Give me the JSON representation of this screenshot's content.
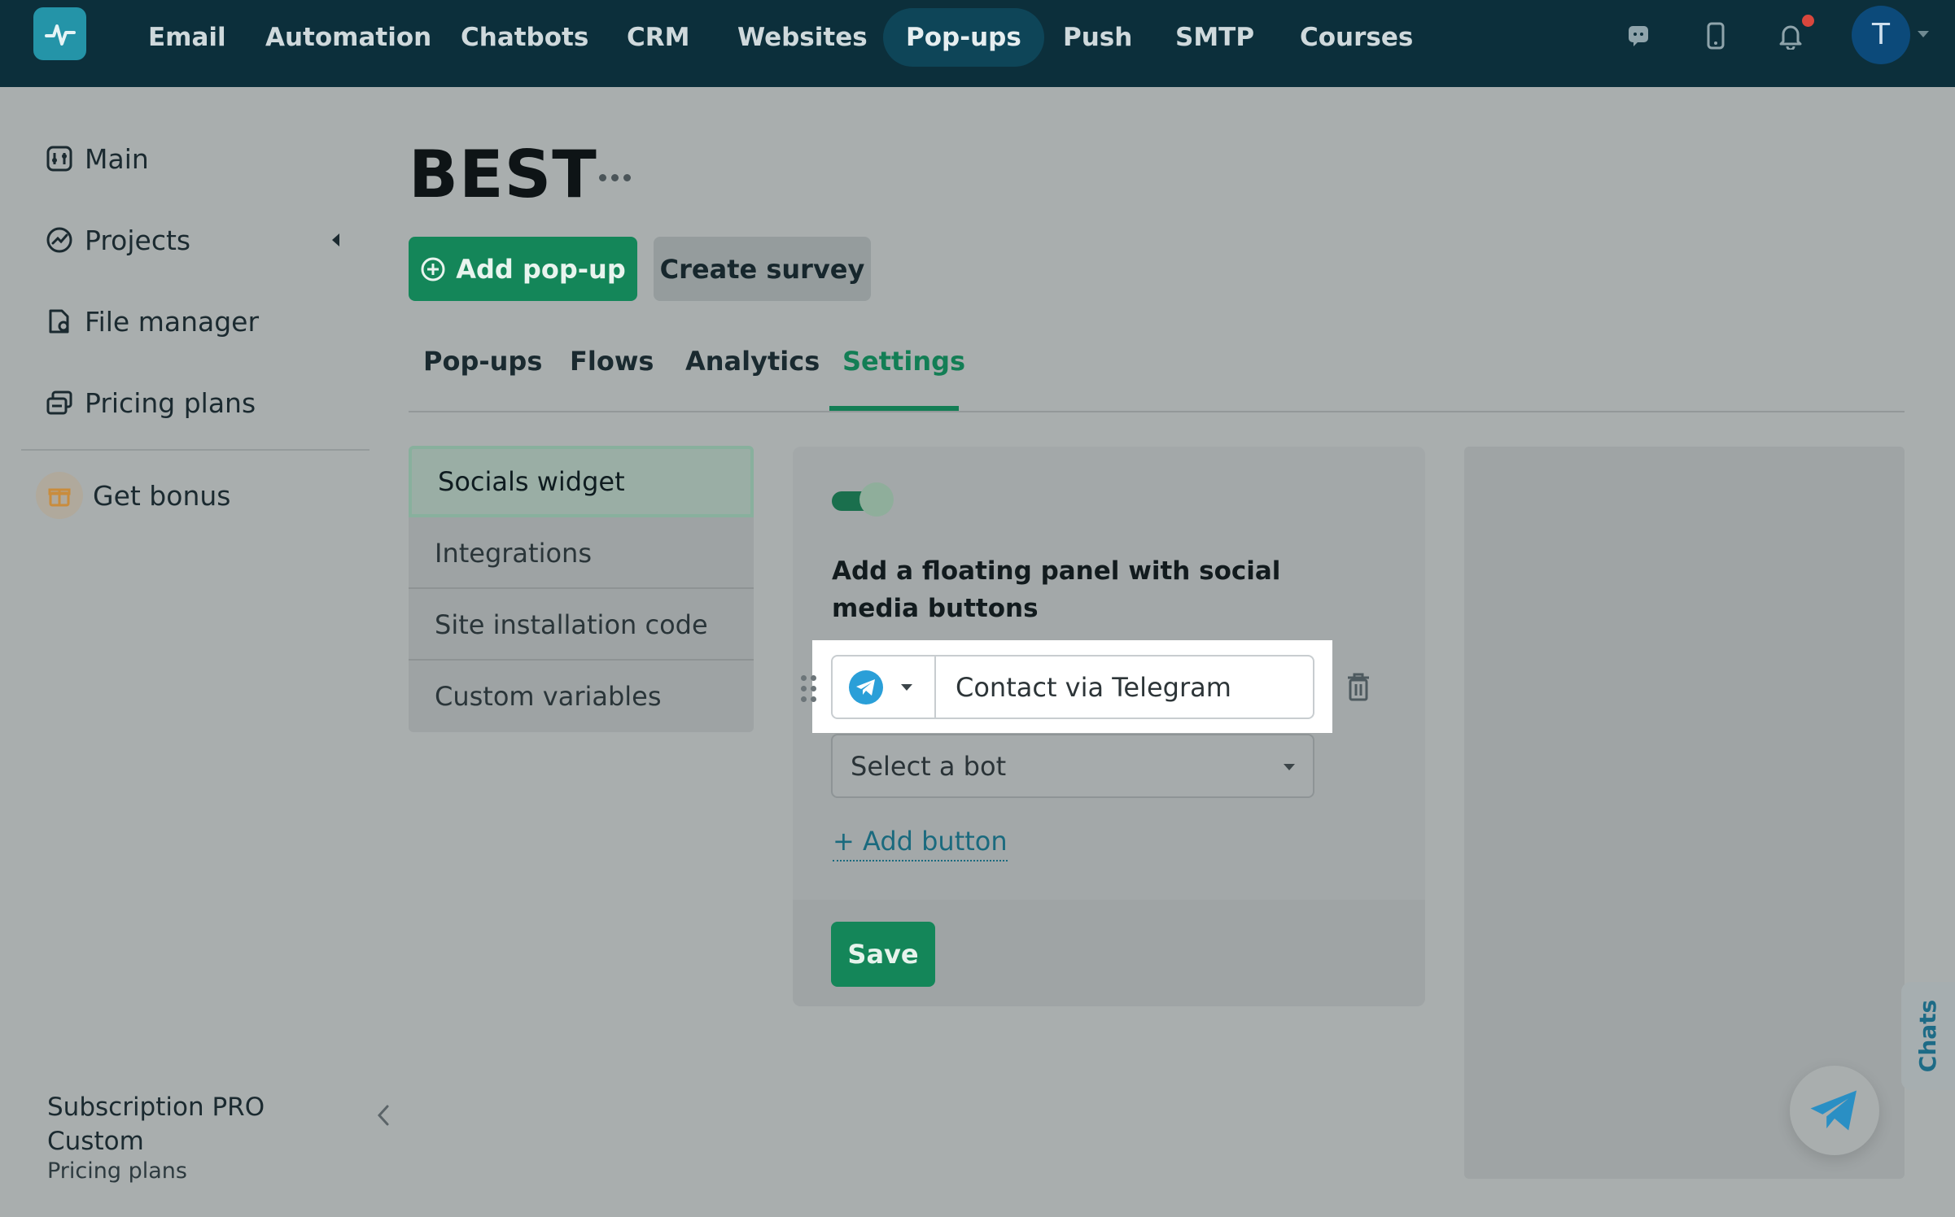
{
  "topnav": {
    "items": [
      {
        "label": "Email"
      },
      {
        "label": "Automation"
      },
      {
        "label": "Chatbots"
      },
      {
        "label": "CRM"
      },
      {
        "label": "Websites"
      },
      {
        "label": "Pop-ups",
        "active": true
      },
      {
        "label": "Push"
      },
      {
        "label": "SMTP"
      },
      {
        "label": "Courses"
      }
    ],
    "icons": [
      "chat-icon",
      "mobile-icon",
      "bell-icon"
    ],
    "avatar_initial": "T",
    "colors": {
      "background": "#0c2f3b",
      "active": "#0e4558",
      "notification": "#d9473d"
    }
  },
  "sidebar": {
    "items": [
      {
        "label": "Main",
        "icon": "dashboard-icon"
      },
      {
        "label": "Projects",
        "icon": "projects-icon"
      },
      {
        "label": "File manager",
        "icon": "file-icon"
      },
      {
        "label": "Pricing plans",
        "icon": "pricing-icon"
      }
    ],
    "bonus": {
      "label": "Get bonus",
      "icon": "gift-icon"
    },
    "subscription": {
      "title": "Subscription PRO Custom",
      "link": "Pricing plans"
    }
  },
  "main": {
    "title": "BEST",
    "buttons": {
      "add": "Add pop-up",
      "survey": "Create survey"
    },
    "tabs": [
      {
        "label": "Pop-ups"
      },
      {
        "label": "Flows"
      },
      {
        "label": "Analytics"
      },
      {
        "label": "Settings",
        "active": true
      }
    ],
    "settings_menu": [
      {
        "label": "Socials widget",
        "active": true
      },
      {
        "label": "Integrations"
      },
      {
        "label": "Site installation code"
      },
      {
        "label": "Custom variables"
      }
    ],
    "panel": {
      "toggle_on": true,
      "heading": "Add a floating panel with social media buttons",
      "social": {
        "network": "Telegram",
        "icon": "telegram-icon",
        "value": "Contact via Telegram"
      },
      "bot_select": "Select a bot",
      "add_button": "+ Add button",
      "save": "Save"
    }
  },
  "chats_tab": "Chats",
  "colors": {
    "primary": "#148659",
    "accent_tab": "#137e55",
    "link": "#1a6a7e",
    "telegram": "#2a9fd8"
  }
}
